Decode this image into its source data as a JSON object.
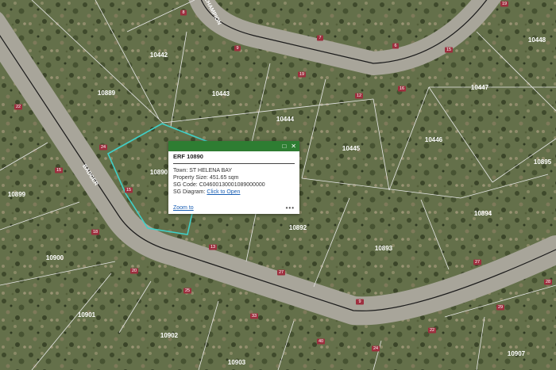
{
  "map": {
    "erf_labels": [
      "10442",
      "10443",
      "10444",
      "10445",
      "10446",
      "10447",
      "10448",
      "10889",
      "10895",
      "10899",
      "10900",
      "10901",
      "10902",
      "10903",
      "10907",
      "10892",
      "10893",
      "10894",
      "10890"
    ],
    "road_names": [
      "CHAMPION",
      "BADGER"
    ],
    "dimension_labels": [
      "8",
      "7",
      "9",
      "6",
      "19",
      "12",
      "16",
      "15",
      "19",
      "24",
      "22",
      "15",
      "13",
      "27",
      "18",
      "15",
      "20",
      "25",
      "33",
      "40",
      "24",
      "22",
      "29",
      "27",
      "28",
      "9"
    ],
    "selected_parcel_color": "#40d0c8",
    "road_color": "#a8a59a"
  },
  "popup": {
    "title": "ERF 10890",
    "town_label": "Town:",
    "town_value": "ST HELENA BAY",
    "size_label": "Property Size:",
    "size_value": "451.65 sqm",
    "sgcode_label": "SG Code:",
    "sgcode_value": "C04600130001089000000",
    "diagram_label": "SG Diagram:",
    "diagram_link": "Click to Open",
    "zoom_link": "Zoom to",
    "more_label": "•••",
    "minimize_icon": "minimize-icon",
    "close_icon": "close-icon",
    "header_color": "#2e7d32"
  }
}
